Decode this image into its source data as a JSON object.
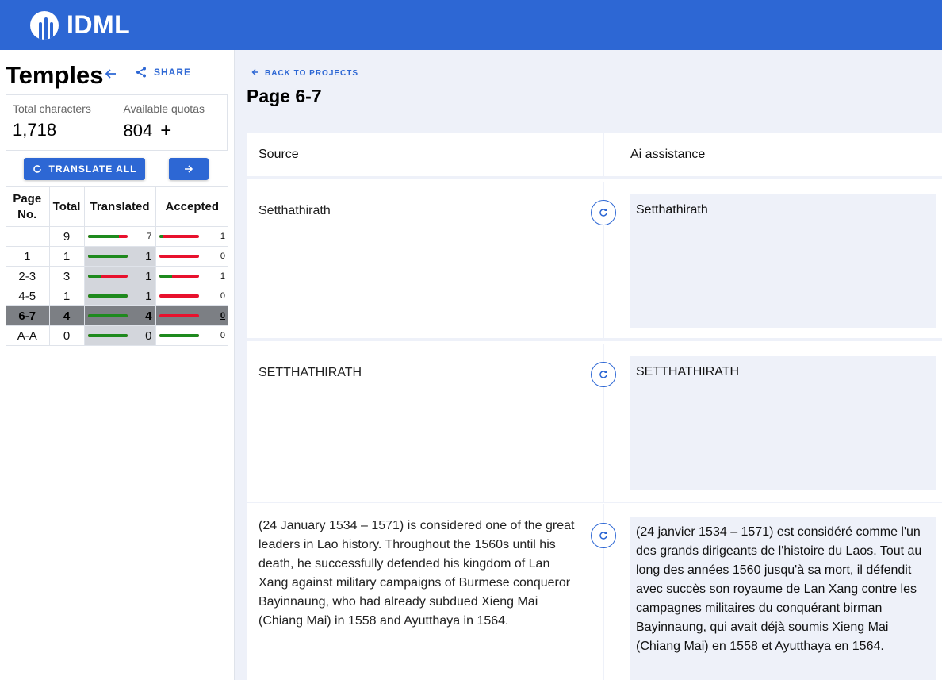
{
  "app": {
    "logo_text": "IDML"
  },
  "sidebar": {
    "project_title": "Temples",
    "share_label": "SHARE",
    "stats": {
      "total_characters_label": "Total characters",
      "total_characters_value": "1,718",
      "available_quotas_label": "Available quotas",
      "available_quotas_value": "804",
      "plus_symbol": "+"
    },
    "translate_all_label": "TRANSLATE ALL",
    "table": {
      "headers": {
        "page_no": "Page No.",
        "total": "Total",
        "translated": "Translated",
        "accepted": "Accepted"
      },
      "rows": [
        {
          "page": "",
          "total": "9",
          "translated": "7",
          "translated_ratio": 0.78,
          "accepted": "1",
          "accepted_ratio": 0.11,
          "selected": false,
          "highlight": false
        },
        {
          "page": "1",
          "total": "1",
          "translated": "1",
          "translated_ratio": 1.0,
          "accepted": "0",
          "accepted_ratio": 0.0,
          "selected": false,
          "highlight": true
        },
        {
          "page": "2-3",
          "total": "3",
          "translated": "1",
          "translated_ratio": 0.33,
          "accepted": "1",
          "accepted_ratio": 0.33,
          "selected": false,
          "highlight": true
        },
        {
          "page": "4-5",
          "total": "1",
          "translated": "1",
          "translated_ratio": 1.0,
          "accepted": "0",
          "accepted_ratio": 0.0,
          "selected": false,
          "highlight": true
        },
        {
          "page": "6-7",
          "total": "4",
          "translated": "4",
          "translated_ratio": 1.0,
          "accepted": "0",
          "accepted_ratio": 0.0,
          "selected": true,
          "highlight": true
        },
        {
          "page": "A-A",
          "total": "0",
          "translated": "0",
          "translated_ratio": 1.0,
          "accepted": "0",
          "accepted_ratio": 1.0,
          "selected": false,
          "highlight": true
        }
      ]
    }
  },
  "main": {
    "back_label": "BACK TO PROJECTS",
    "page_title": "Page 6-7",
    "columns": {
      "source": "Source",
      "ai": "Ai assistance"
    },
    "segments": [
      {
        "source": "Setthathirath",
        "ai": "Setthathirath"
      },
      {
        "source": "SETTHATHIRATH",
        "ai": "SETTHATHIRATH"
      },
      {
        "source": "(24 January 1534 – 1571) is considered one of the great leaders in Lao history. Throughout the 1560s until his death, he successfully defended his kingdom of Lan Xang against military campaigns of Burmese conqueror Bayinnaung, who had already subdued Xieng Mai (Chiang Mai) in 1558 and Ayutthaya in 1564.",
        "ai": "(24 janvier 1534 – 1571) est considéré comme l'un des grands dirigeants de l'histoire du Laos. Tout au long des années 1560 jusqu'à sa mort, il défendit avec succès son royaume de Lan Xang contre les campagnes militaires du conquérant birman Bayinnaung, qui avait déjà soumis Xieng Mai (Chiang Mai) en 1558 et Ayutthaya en 1564."
      }
    ]
  },
  "colors": {
    "brand": "#2d67d4",
    "progress_done": "#1e8a1e",
    "progress_todo": "#e8112d"
  }
}
